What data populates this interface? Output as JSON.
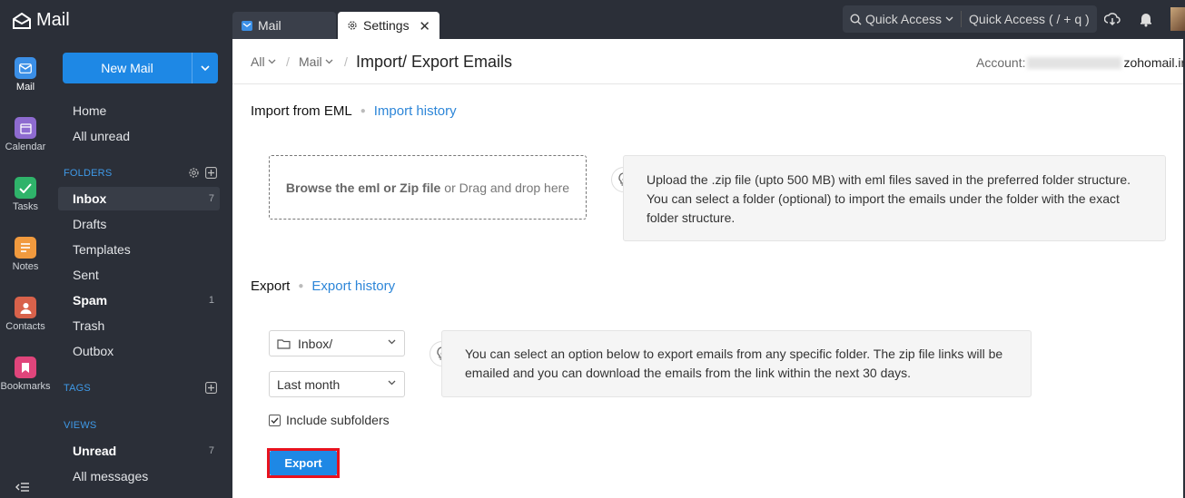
{
  "app": {
    "name": "Mail"
  },
  "tabs": [
    {
      "label": "Mail"
    },
    {
      "label": "Settings"
    }
  ],
  "topbar": {
    "quick_access_menu": "Quick Access",
    "quick_access_search": "Quick Access",
    "shortcut_hint": "( / + q )"
  },
  "rail": [
    {
      "label": "Mail",
      "color": "#3b8fe6"
    },
    {
      "label": "Calendar",
      "color": "#8e6bd0"
    },
    {
      "label": "Tasks",
      "color": "#2fb36a"
    },
    {
      "label": "Notes",
      "color": "#f19a3e"
    },
    {
      "label": "Contacts",
      "color": "#d8624b"
    },
    {
      "label": "Bookmarks",
      "color": "#e0457b"
    }
  ],
  "folder_pane": {
    "new_mail": "New Mail",
    "quick": [
      {
        "label": "Home"
      },
      {
        "label": "All unread"
      }
    ],
    "folders_header": "FOLDERS",
    "folders": [
      {
        "label": "Inbox",
        "count": "7"
      },
      {
        "label": "Drafts"
      },
      {
        "label": "Templates"
      },
      {
        "label": "Sent"
      },
      {
        "label": "Spam",
        "count": "1"
      },
      {
        "label": "Trash"
      },
      {
        "label": "Outbox"
      }
    ],
    "tags_header": "TAGS",
    "views_header": "VIEWS",
    "views": [
      {
        "label": "Unread",
        "count": "7"
      },
      {
        "label": "All messages"
      }
    ]
  },
  "breadcrumb": {
    "all": "All",
    "mail": "Mail",
    "title": "Import/ Export Emails",
    "account_label": "Account:",
    "account_suffix": "zohomail.in"
  },
  "import": {
    "title": "Import from EML",
    "history_link": "Import history",
    "drop_bold": "Browse the eml or Zip file",
    "drop_rest": "or Drag and drop here",
    "info": "Upload the .zip file (upto 500 MB) with eml files saved in the preferred folder structure. You can select a folder (optional) to import the emails under the folder with the exact folder structure."
  },
  "export": {
    "title": "Export",
    "history_link": "Export history",
    "folder_value": "Inbox/",
    "range_value": "Last month",
    "include_subfolders": "Include subfolders",
    "include_checked": true,
    "info": "You can select an option below to export emails from any specific folder. The zip file links will be emailed and you can download the emails from the link within the next 30 days.",
    "button": "Export"
  }
}
